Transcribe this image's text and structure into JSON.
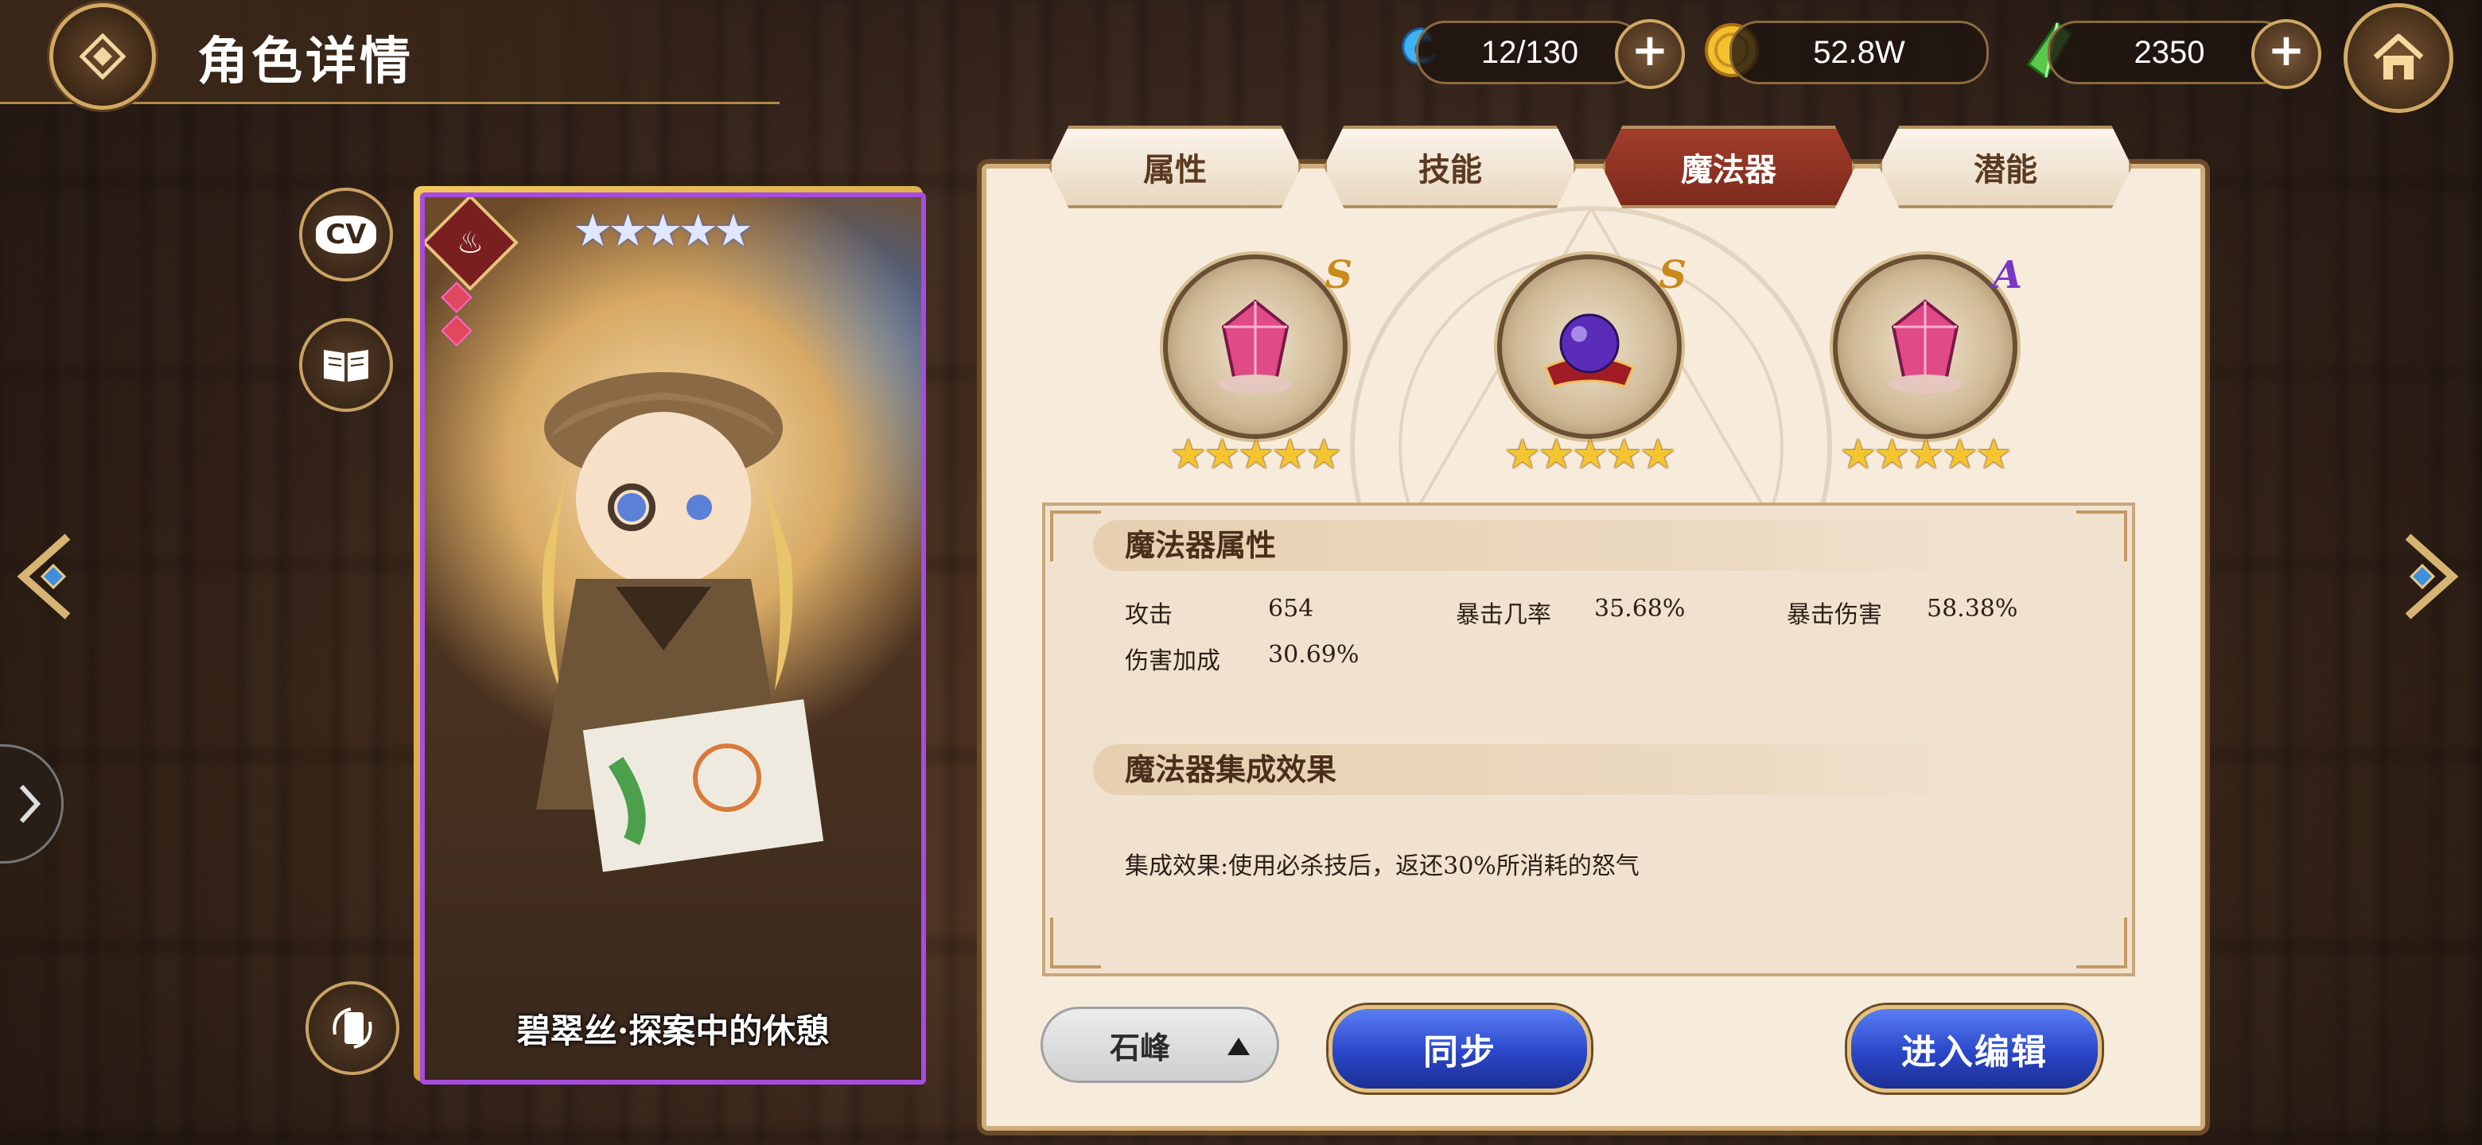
{
  "header": {
    "title": "角色详情"
  },
  "resources": {
    "stamina": {
      "value": "12/130",
      "icon": "blue-spirit-icon"
    },
    "gold": {
      "value": "52.8W",
      "icon": "gold-coin-icon"
    },
    "gems": {
      "value": "2350",
      "icon": "green-crystal-icon"
    }
  },
  "side_buttons": {
    "cv_label": "CV"
  },
  "card": {
    "name": "碧翠丝·探案中的休憩",
    "stars": "★★★★★",
    "element_icon": "fire-icon"
  },
  "tabs": [
    {
      "label": "属性",
      "active": false
    },
    {
      "label": "技能",
      "active": false
    },
    {
      "label": "魔法器",
      "active": true
    },
    {
      "label": "潜能",
      "active": false
    }
  ],
  "artifacts": [
    {
      "icon": "pink-crystal-icon",
      "grade": "S",
      "grade_color": "#c98a1a",
      "stars": "★★★★★"
    },
    {
      "icon": "purple-orb-icon",
      "grade": "S",
      "grade_color": "#c98a1a",
      "stars": "★★★★★"
    },
    {
      "icon": "pink-crystal-icon",
      "grade": "A",
      "grade_color": "#7a34c8",
      "stars": "★★★★★"
    }
  ],
  "attributes": {
    "header": "魔法器属性",
    "atk_label": "攻击",
    "atk_value": "654",
    "crit_rate_label": "暴击几率",
    "crit_rate_value": "35.68%",
    "crit_dmg_label": "暴击伤害",
    "crit_dmg_value": "58.38%",
    "dmg_bonus_label": "伤害加成",
    "dmg_bonus_value": "30.69%"
  },
  "set_effect": {
    "header": "魔法器集成效果",
    "text": "集成效果:使用必杀技后，返还30%所消耗的怒气"
  },
  "bottom": {
    "select_value": "石峰",
    "sync_label": "同步",
    "edit_label": "进入编辑"
  },
  "colors": {
    "active_tab": "#8f3322",
    "button_blue": "#2a46c8",
    "star_gold": "#f4c531"
  }
}
